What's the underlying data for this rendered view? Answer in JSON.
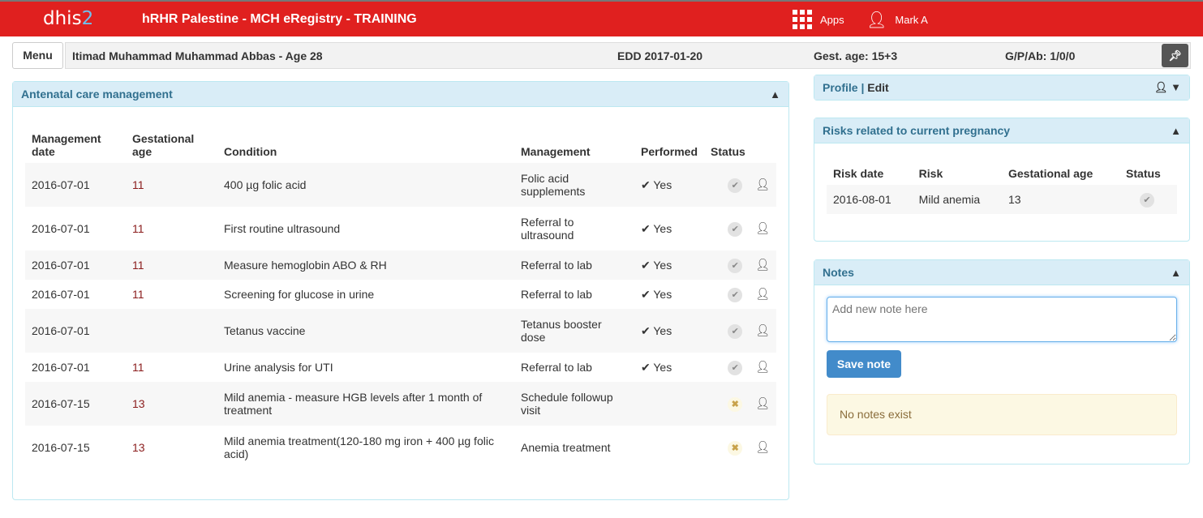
{
  "header": {
    "logo": "dhis",
    "logo_num": "2",
    "title": "hRHR Palestine - MCH eRegistry - TRAINING",
    "apps": "Apps",
    "user": "Mark A"
  },
  "infobar": {
    "menu": "Menu",
    "patient": "Itimad Muhammad Muhammad Abbas - Age 28",
    "edd": "EDD 2017-01-20",
    "gest": "Gest. age: 15+3",
    "gpab": "G/P/Ab: 1/0/0"
  },
  "anc": {
    "title": "Antenatal care management",
    "headers": [
      "Management date",
      "Gestational age",
      "Condition",
      "Management",
      "Performed",
      "Status"
    ],
    "rows": [
      {
        "date": "2016-07-01",
        "ga": "11",
        "condition": "400 µg folic acid",
        "management": "Folic acid supplements",
        "performed": "Yes",
        "status": "done"
      },
      {
        "date": "2016-07-01",
        "ga": "11",
        "condition": "First routine ultrasound",
        "management": "Referral to ultrasound",
        "performed": "Yes",
        "status": "done"
      },
      {
        "date": "2016-07-01",
        "ga": "11",
        "condition": "Measure hemoglobin ABO & RH",
        "management": "Referral to lab",
        "performed": "Yes",
        "status": "done"
      },
      {
        "date": "2016-07-01",
        "ga": "11",
        "condition": "Screening for glucose in urine",
        "management": "Referral to lab",
        "performed": "Yes",
        "status": "done"
      },
      {
        "date": "2016-07-01",
        "ga": "",
        "condition": "Tetanus vaccine",
        "management": "Tetanus booster dose",
        "performed": "Yes",
        "status": "done"
      },
      {
        "date": "2016-07-01",
        "ga": "11",
        "condition": "Urine analysis for UTI",
        "management": "Referral to lab",
        "performed": "Yes",
        "status": "done"
      },
      {
        "date": "2016-07-15",
        "ga": "13",
        "condition": "Mild anemia - measure HGB levels after 1 month of treatment",
        "management": "Schedule followup visit",
        "performed": "",
        "status": "pending"
      },
      {
        "date": "2016-07-15",
        "ga": "13",
        "condition": "Mild anemia treatment(120-180 mg iron + 400 µg folic acid)",
        "management": "Anemia treatment",
        "performed": "",
        "status": "pending"
      }
    ]
  },
  "profile": {
    "title": "Profile",
    "sep": "|",
    "edit": "Edit"
  },
  "risks": {
    "title": "Risks related to current pregnancy",
    "headers": [
      "Risk date",
      "Risk",
      "Gestational age",
      "Status"
    ],
    "rows": [
      {
        "date": "2016-08-01",
        "risk": "Mild anemia",
        "ga": "13",
        "status": "done"
      }
    ]
  },
  "notes": {
    "title": "Notes",
    "placeholder": "Add new note here",
    "save": "Save note",
    "empty": "No notes exist"
  }
}
